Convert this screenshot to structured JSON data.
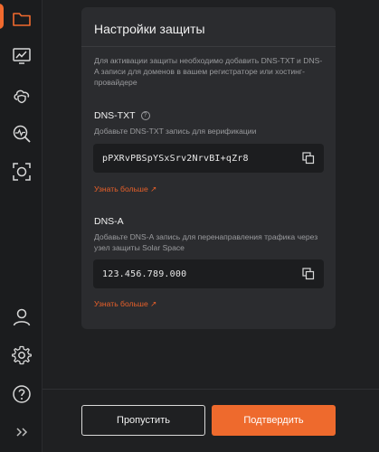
{
  "sidebar": {
    "items": [
      {
        "icon": "folder-icon",
        "active": true
      },
      {
        "icon": "monitor-chart-icon",
        "active": false
      },
      {
        "icon": "cloud-shield-icon",
        "active": false
      },
      {
        "icon": "pulse-search-icon",
        "active": false
      },
      {
        "icon": "scan-frame-icon",
        "active": false
      }
    ],
    "bottom_items": [
      {
        "icon": "user-icon"
      },
      {
        "icon": "gear-icon"
      },
      {
        "icon": "help-icon"
      },
      {
        "icon": "expand-chevrons-icon"
      }
    ]
  },
  "card": {
    "title": "Настройки защиты",
    "intro": "Для активации защиты необходимо добавить DNS-TXT и DNS-A записи для доменов в вашем регистраторе или хостинг-провайдере",
    "dns_txt": {
      "title": "DNS-TXT",
      "description": "Добавьте DNS-TXT запись для верификации",
      "value": "pPXRvPBSpYSxSrv2NrvBI+qZr8",
      "learn_more": "Узнать больше ↗"
    },
    "dns_a": {
      "title": "DNS-A",
      "description": "Добавьте DNS-A запись для перенаправления трафика через узел защиты Solar Space",
      "value": "123.456.789.000",
      "learn_more": "Узнать больше ↗"
    }
  },
  "footer": {
    "skip_label": "Пропустить",
    "confirm_label": "Подтвердить"
  },
  "colors": {
    "accent": "#ee6a2d",
    "background": "#1f2022",
    "card": "#2b2c2f"
  }
}
